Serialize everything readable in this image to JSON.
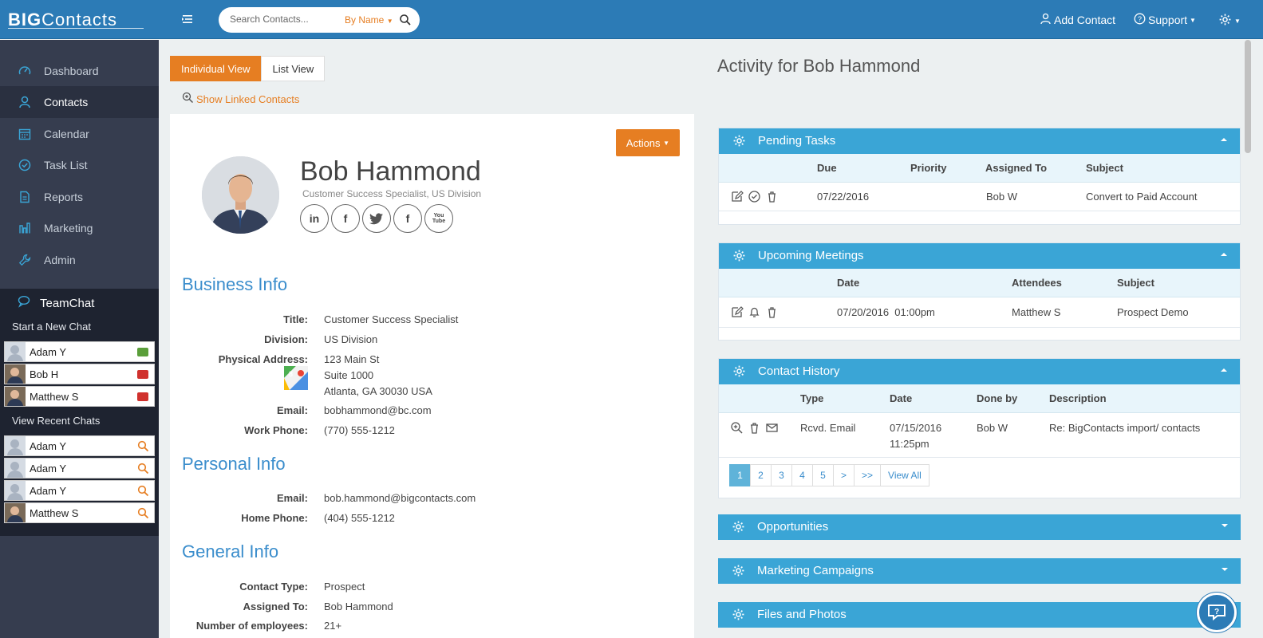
{
  "app": {
    "logo_bold": "BIG",
    "logo_rest": "Contacts"
  },
  "search": {
    "placeholder": "Search Contacts...",
    "mode": "By Name"
  },
  "topnav": {
    "add_contact": "Add Contact",
    "support": "Support"
  },
  "sidebar": {
    "items": [
      {
        "label": "Dashboard",
        "icon": "dashboard-icon"
      },
      {
        "label": "Contacts",
        "icon": "user-icon",
        "active": true
      },
      {
        "label": "Calendar",
        "icon": "calendar-icon"
      },
      {
        "label": "Task List",
        "icon": "check-circle-icon"
      },
      {
        "label": "Reports",
        "icon": "document-icon"
      },
      {
        "label": "Marketing",
        "icon": "bar-chart-icon"
      },
      {
        "label": "Admin",
        "icon": "wrench-icon"
      }
    ]
  },
  "teamchat": {
    "title": "TeamChat",
    "start_new": "Start a New Chat",
    "online": [
      {
        "name": "Adam Y",
        "status_color": "#5a9e3a"
      },
      {
        "name": "Bob H",
        "status_color": "#d0312d"
      },
      {
        "name": "Matthew S",
        "status_color": "#d0312d"
      }
    ],
    "recent_label": "View Recent Chats",
    "recent": [
      {
        "name": "Adam Y"
      },
      {
        "name": "Adam Y"
      },
      {
        "name": "Adam Y"
      },
      {
        "name": "Matthew S"
      }
    ]
  },
  "view_tabs": {
    "individual": "Individual View",
    "list": "List View"
  },
  "show_linked": "Show Linked Contacts",
  "actions_label": "Actions",
  "contact": {
    "name": "Bob Hammond",
    "subtitle": "Customer Success Specialist,  US Division",
    "socials": [
      "in",
      "f",
      "t",
      "f",
      "You Tube"
    ]
  },
  "business_info": {
    "heading": "Business Info",
    "title_label": "Title:",
    "title": "Customer Success Specialist",
    "division_label": "Division:",
    "division": "US Division",
    "address_label": "Physical Address:",
    "address_line1": "123 Main St",
    "address_line2": "Suite 1000",
    "address_line3": "Atlanta, GA 30030 USA",
    "email_label": "Email:",
    "email": "bobhammond@bc.com",
    "work_phone_label": "Work Phone:",
    "work_phone": "(770) 555-1212"
  },
  "personal_info": {
    "heading": "Personal Info",
    "email_label": "Email:",
    "email": "bob.hammond@bigcontacts.com",
    "home_phone_label": "Home Phone:",
    "home_phone": "(404) 555-1212"
  },
  "general_info": {
    "heading": "General Info",
    "contact_type_label": "Contact Type:",
    "contact_type": "Prospect",
    "assigned_to_label": "Assigned To:",
    "assigned_to": "Bob Hammond",
    "employees_label": "Number of employees:",
    "employees": "21+"
  },
  "activity": {
    "title": "Activity for Bob Hammond",
    "pending_tasks": {
      "title": "Pending Tasks",
      "columns": {
        "due": "Due",
        "priority": "Priority",
        "assigned": "Assigned To",
        "subject": "Subject"
      },
      "rows": [
        {
          "due": "07/22/2016",
          "priority": "",
          "assigned": "Bob W",
          "subject": "Convert to Paid Account"
        }
      ]
    },
    "upcoming_meetings": {
      "title": "Upcoming Meetings",
      "columns": {
        "date": "Date",
        "attendees": "Attendees",
        "subject": "Subject"
      },
      "rows": [
        {
          "date": "07/20/2016  01:00pm",
          "attendees": "Matthew S",
          "subject": "Prospect Demo"
        }
      ]
    },
    "contact_history": {
      "title": "Contact History",
      "columns": {
        "type": "Type",
        "date": "Date",
        "done_by": "Done by",
        "description": "Description"
      },
      "rows": [
        {
          "type": "Rcvd. Email",
          "date": "07/15/2016",
          "time": "11:25pm",
          "done_by": "Bob W",
          "description": "Re: BigContacts import/ contacts"
        }
      ],
      "pages": [
        "1",
        "2",
        "3",
        "4",
        "5",
        ">",
        ">>",
        "View All"
      ]
    },
    "opportunities": {
      "title": "Opportunities"
    },
    "marketing_campaigns": {
      "title": "Marketing Campaigns"
    },
    "files_photos": {
      "title": "Files and Photos"
    }
  },
  "colors": {
    "brand_blue": "#2c7bb6",
    "panel_blue": "#3aa5d6",
    "accent_orange": "#e67e22",
    "sidebar": "#363d4f"
  }
}
